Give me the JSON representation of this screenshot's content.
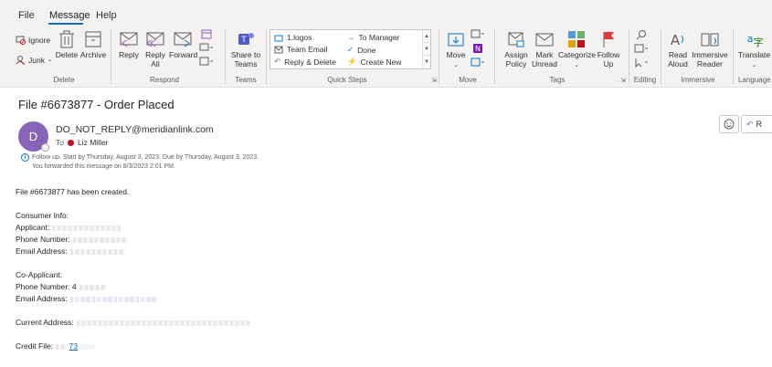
{
  "menu": {
    "tabs": [
      {
        "label": "File"
      },
      {
        "label": "Message"
      },
      {
        "label": "Help"
      }
    ]
  },
  "ribbon": {
    "delete_group": {
      "ignore": "Ignore",
      "junk": "Junk",
      "delete": "Delete",
      "archive": "Archive",
      "label": "Delete"
    },
    "respond_group": {
      "reply": "Reply",
      "reply_all_1": "Reply",
      "reply_all_2": "All",
      "forward": "Forward",
      "label": "Respond"
    },
    "teams_group": {
      "share_1": "Share to",
      "share_2": "Teams",
      "label": "Teams"
    },
    "quick_steps": {
      "items": [
        "1.logos",
        "To Manager",
        "Team Email",
        "Done",
        "Reply & Delete",
        "Create New"
      ],
      "label": "Quick Steps"
    },
    "move_group": {
      "move": "Move",
      "label": "Move"
    },
    "tags_group": {
      "assign_1": "Assign",
      "assign_2": "Policy",
      "mark_1": "Mark",
      "mark_2": "Unread",
      "categorize": "Categorize",
      "followup_1": "Follow",
      "followup_2": "Up",
      "label": "Tags"
    },
    "editing_group": {
      "label": "Editing"
    },
    "immersive_group": {
      "read_1": "Read",
      "read_2": "Aloud",
      "reader_1": "Immersive",
      "reader_2": "Reader",
      "label": "Immersive"
    },
    "language_group": {
      "translate": "Translate",
      "label": "Language"
    }
  },
  "message": {
    "subject": "File #6673877 - Order Placed",
    "avatar_initial": "D",
    "sender": "DO_NOT_REPLY@meridianlink.com",
    "to_label": "To",
    "to_name": "Liz Miller",
    "followup_info": "Follow up.  Start by Thursday, August 3, 2023.  Due by Thursday, August 3, 2023.",
    "forward_info": "You forwarded this message on 8/3/2023 2:01 PM.",
    "reply_label": "R"
  },
  "body": {
    "line_created": "File #6673877 has been created.",
    "consumer_info": "Consumer Info:",
    "applicant": "Applicant:",
    "phone": "Phone Number:",
    "email": "Email Address:",
    "co_applicant": "Co-Applicant:",
    "co_phone": "Phone Number: 4",
    "co_email": "Email Address:",
    "current_address": "Current Address:",
    "credit_file": "Credit File:",
    "credit_file_link": "73"
  },
  "colors": {
    "accent": "#106ebe",
    "avatar": "#8764b8",
    "presence": "#c50f1f",
    "link": "#0563c1"
  }
}
